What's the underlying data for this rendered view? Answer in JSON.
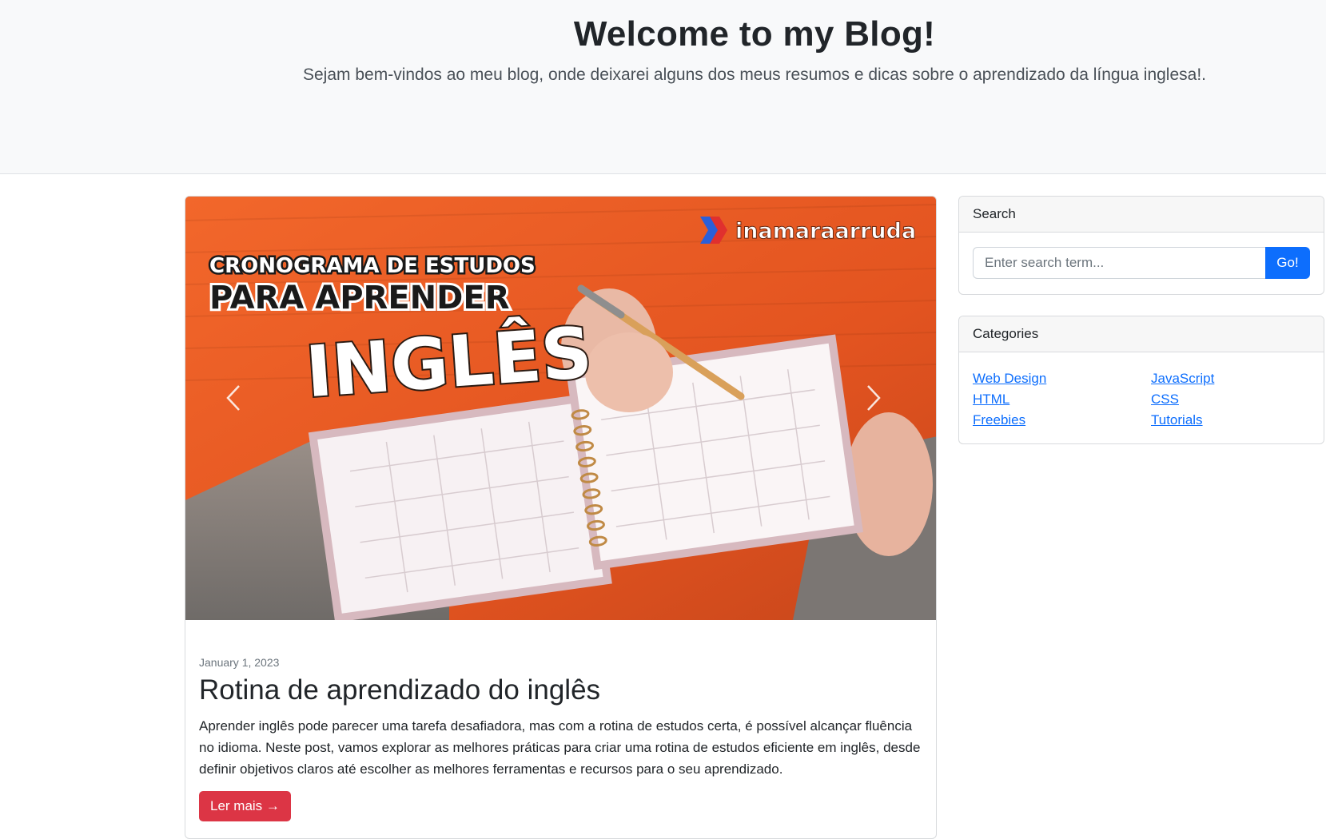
{
  "header": {
    "title": "Welcome to my Blog!",
    "subtitle": "Sejam bem-vindos ao meu blog, onde deixarei alguns dos meus resumos e dicas sobre o aprendizado da língua inglesa!."
  },
  "post": {
    "image": {
      "brand": "inamaraarruda",
      "line1": "CRONOGRAMA DE ESTUDOS",
      "line2": "PARA APRENDER",
      "line3": "INGLÊS"
    },
    "date": "January 1, 2023",
    "title": "Rotina de aprendizado do inglês",
    "excerpt": "Aprender inglês pode parecer uma tarefa desafiadora, mas com a rotina de estudos certa, é possível alcançar fluência no idioma. Neste post, vamos explorar as melhores práticas para criar uma rotina de estudos eficiente em inglês, desde definir objetivos claros até escolher as melhores ferramentas e recursos para o seu aprendizado.",
    "read_more": "Ler mais →"
  },
  "sidebar": {
    "search": {
      "header": "Search",
      "placeholder": "Enter search term...",
      "button": "Go!"
    },
    "categories": {
      "header": "Categories",
      "left": [
        "Web Design",
        "HTML",
        "Freebies"
      ],
      "right": [
        "JavaScript",
        "CSS",
        "Tutorials"
      ]
    }
  },
  "colors": {
    "primary": "#0d6efd",
    "danger": "#dc3545",
    "hero_bg": "#f8f9fa"
  }
}
